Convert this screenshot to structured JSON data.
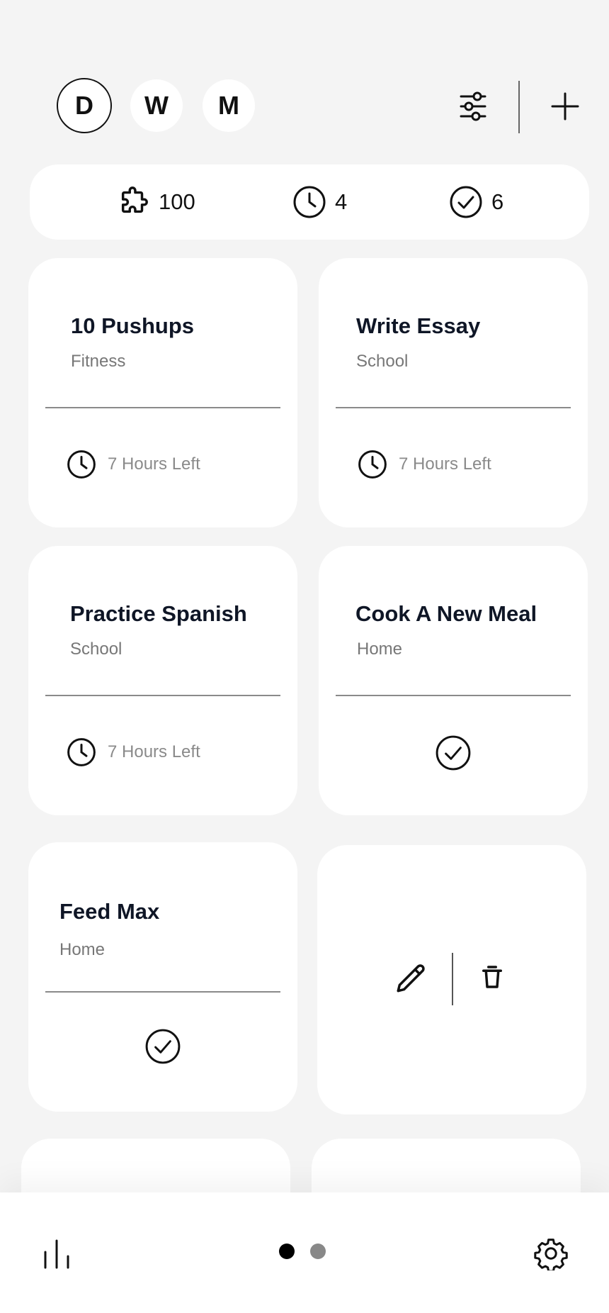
{
  "header": {
    "period_buttons": [
      {
        "label": "D",
        "active": true
      },
      {
        "label": "W",
        "active": false
      },
      {
        "label": "M",
        "active": false
      }
    ],
    "icons": {
      "filter": "sliders-icon",
      "add": "plus-icon"
    }
  },
  "stats": {
    "points": {
      "icon": "puzzle-icon",
      "value": "100"
    },
    "pending": {
      "icon": "clock-icon",
      "value": "4"
    },
    "completed": {
      "icon": "check-circle-icon",
      "value": "6"
    }
  },
  "tasks": [
    {
      "title": "10 Pushups",
      "category": "Fitness",
      "footer": "7 Hours Left",
      "status": "pending"
    },
    {
      "title": "Write Essay",
      "category": "School",
      "footer": "7 Hours Left",
      "status": "pending"
    },
    {
      "title": "Practice Spanish",
      "category": "School",
      "footer": "7 Hours Left",
      "status": "pending"
    },
    {
      "title": "Cook A New Meal",
      "category": "Home",
      "status": "completed"
    },
    {
      "title": "Feed Max",
      "category": "Home",
      "status": "completed"
    }
  ],
  "actions_card": {
    "icons": [
      "pencil-icon",
      "trash-icon"
    ]
  },
  "bottom_nav": {
    "icons": {
      "stats": "bar-chart-icon",
      "settings": "gear-icon"
    },
    "page_indicator": {
      "current": 1,
      "total": 2
    }
  },
  "colors": {
    "background": "#f4f4f4",
    "card": "#ffffff",
    "text_primary": "#0f1626",
    "text_secondary": "#8a8a8a"
  }
}
